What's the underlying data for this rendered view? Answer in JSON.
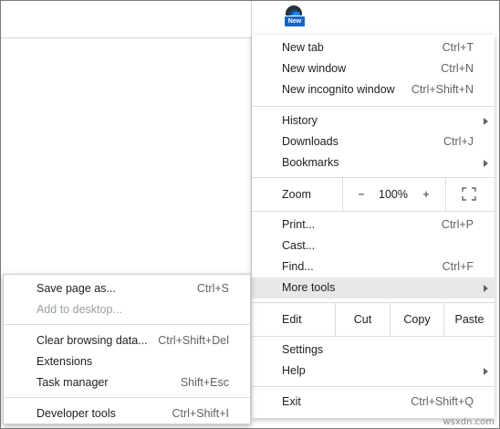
{
  "profile": {
    "badge": "New"
  },
  "menu": {
    "new_tab": {
      "label": "New tab",
      "shortcut": "Ctrl+T"
    },
    "new_window": {
      "label": "New window",
      "shortcut": "Ctrl+N"
    },
    "new_incognito": {
      "label": "New incognito window",
      "shortcut": "Ctrl+Shift+N"
    },
    "history": {
      "label": "History"
    },
    "downloads": {
      "label": "Downloads",
      "shortcut": "Ctrl+J"
    },
    "bookmarks": {
      "label": "Bookmarks"
    },
    "zoom": {
      "label": "Zoom",
      "minus": "−",
      "value": "100%",
      "plus": "+"
    },
    "print": {
      "label": "Print...",
      "shortcut": "Ctrl+P"
    },
    "cast": {
      "label": "Cast..."
    },
    "find": {
      "label": "Find...",
      "shortcut": "Ctrl+F"
    },
    "more_tools": {
      "label": "More tools"
    },
    "edit": {
      "label": "Edit",
      "cut": "Cut",
      "copy": "Copy",
      "paste": "Paste"
    },
    "settings": {
      "label": "Settings"
    },
    "help": {
      "label": "Help"
    },
    "exit": {
      "label": "Exit",
      "shortcut": "Ctrl+Shift+Q"
    }
  },
  "submenu": {
    "save_page": {
      "label": "Save page as...",
      "shortcut": "Ctrl+S"
    },
    "add_desktop": {
      "label": "Add to desktop..."
    },
    "clear_data": {
      "label": "Clear browsing data...",
      "shortcut": "Ctrl+Shift+Del"
    },
    "extensions": {
      "label": "Extensions"
    },
    "task_manager": {
      "label": "Task manager",
      "shortcut": "Shift+Esc"
    },
    "dev_tools": {
      "label": "Developer tools",
      "shortcut": "Ctrl+Shift+I"
    }
  },
  "watermark": "wsxdn.com"
}
